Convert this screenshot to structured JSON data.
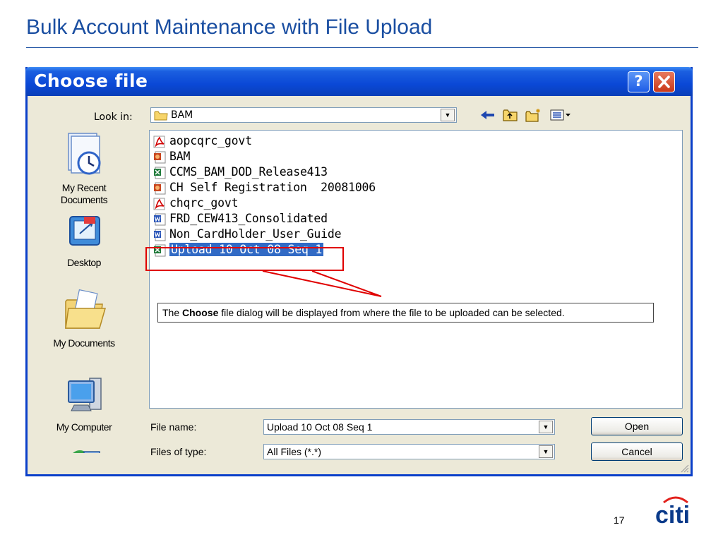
{
  "slide": {
    "title": "Bulk Account Maintenance with File Upload",
    "page_number": "17",
    "logo_text": "citi"
  },
  "dialog": {
    "title": "Choose file",
    "help_label": "?",
    "close_label": "X",
    "look_in_label": "Look in:",
    "look_in_value": "BAM",
    "toolbar_icons": [
      "back-icon",
      "up-folder-icon",
      "new-folder-icon",
      "view-menu-icon"
    ],
    "places": [
      {
        "label": "My Recent Documents",
        "icon": "recent-documents-icon"
      },
      {
        "label": "Desktop",
        "icon": "desktop-icon"
      },
      {
        "label": "My Documents",
        "icon": "my-documents-icon"
      },
      {
        "label": "My Computer",
        "icon": "my-computer-icon"
      },
      {
        "label": "",
        "icon": "network-places-icon"
      }
    ],
    "files": [
      {
        "name": "aopcqrc_govt",
        "icon": "pdf-icon",
        "selected": false
      },
      {
        "name": "BAM",
        "icon": "powerpoint-icon",
        "selected": false
      },
      {
        "name": "CCMS_BAM_DOD_Release413",
        "icon": "excel-icon",
        "selected": false
      },
      {
        "name": "CH Self Registration  20081006",
        "icon": "powerpoint-icon",
        "selected": false
      },
      {
        "name": "chqrc_govt",
        "icon": "pdf-icon",
        "selected": false
      },
      {
        "name": "FRD_CEW413_Consolidated",
        "icon": "word-icon",
        "selected": false
      },
      {
        "name": "Non_CardHolder_User_Guide",
        "icon": "word-icon",
        "selected": false
      },
      {
        "name": "Upload 10 Oct 08 Seq 1",
        "icon": "excel-icon",
        "selected": true
      }
    ],
    "file_name_label": "File name:",
    "file_name_value": "Upload 10 Oct 08 Seq 1",
    "file_type_label": "Files of type:",
    "file_type_value": "All Files (*.*)",
    "open_label": "Open",
    "cancel_label": "Cancel"
  },
  "callout": {
    "text_before": "The ",
    "text_bold": "Choose",
    "text_after": " file dialog will be displayed from where the file to be uploaded can be selected."
  },
  "colors": {
    "title_blue": "#1a4ea1",
    "xp_titlebar": "#0a48d6",
    "selection": "#316ac5",
    "highlight_red": "#e00000"
  }
}
